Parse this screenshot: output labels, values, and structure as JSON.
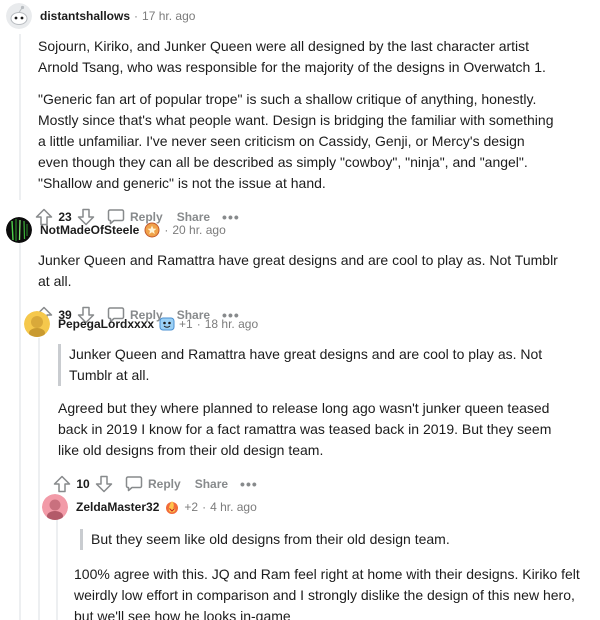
{
  "comments": [
    {
      "username": "distantshallows",
      "timestamp": "17 hr. ago",
      "paragraphs": [
        "Sojourn, Kiriko, and Junker Queen were all designed by the last character artist Arnold Tsang, who was responsible for the majority of the designs in Overwatch 1.",
        "\"Generic fan art of popular trope\" is such a shallow critique of anything, honestly. Mostly since that's what people want. Design is bridging the familiar with something a little unfamiliar. I've never seen criticism on Cassidy, Genji, or Mercy's design even though they can all be described as simply \"cowboy\", \"ninja\", and \"angel\". \"Shallow and generic\" is not the issue at hand."
      ],
      "score": "23",
      "reply_label": "Reply",
      "share_label": "Share",
      "more_label": "•••"
    },
    {
      "username": "NotMadeOfSteele",
      "timestamp": "20 hr. ago",
      "paragraphs": [
        "Junker Queen and Ramattra have great designs and are cool to play as. Not Tumblr at all."
      ],
      "score": "39",
      "reply_label": "Reply",
      "share_label": "Share",
      "more_label": "•••"
    },
    {
      "username": "PepegaLordxxxx",
      "plus": "+1",
      "timestamp": "18 hr. ago",
      "quote": "Junker Queen and Ramattra have great designs and are cool to play as. Not Tumblr at all.",
      "paragraphs": [
        "Agreed but they where planned to release long ago wasn't junker queen teased back in 2019 I know for a fact ramattra was teased back in 2019. But they seem like old designs from their old design team."
      ],
      "score": "10",
      "reply_label": "Reply",
      "share_label": "Share",
      "more_label": "•••"
    },
    {
      "username": "ZeldaMaster32",
      "plus": "+2",
      "timestamp": "4 hr. ago",
      "quote": "But they seem like old designs from their old design team.",
      "paragraphs": [
        "100% agree with this. JQ and Ram feel right at home with their designs. Kiriko felt weirdly low effort in comparison and I strongly dislike the design of this new hero, but we'll see how he looks in-game"
      ]
    }
  ],
  "separator": "·",
  "colors": {
    "meta": "#7c7c7c",
    "action": "#878a8c",
    "thread_line": "#edeff1",
    "quote_border": "#c9ccd0",
    "avatar_yellow": "#f5c84c",
    "avatar_pink": "#f29ba8"
  }
}
